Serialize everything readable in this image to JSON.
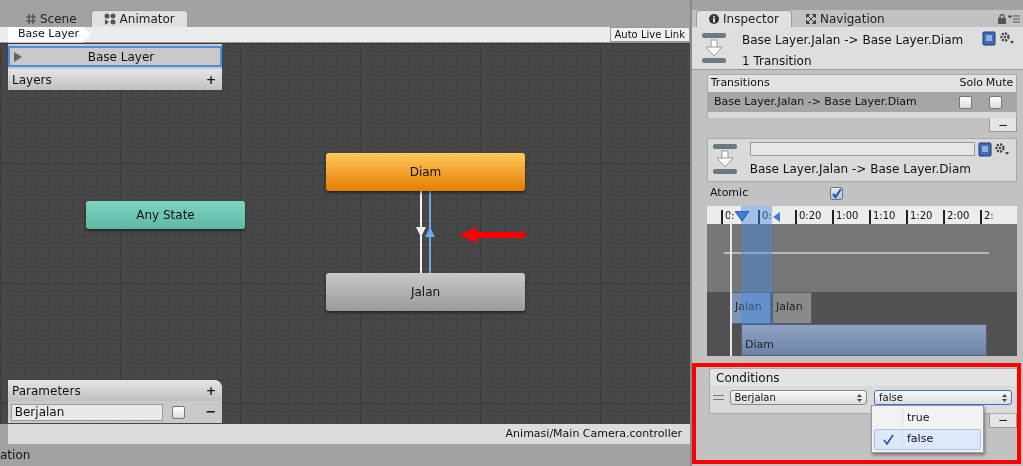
{
  "left_tabs": [
    {
      "label": "Scene",
      "kind": "scene",
      "selected": false
    },
    {
      "label": "Animator",
      "kind": "animator",
      "selected": true
    }
  ],
  "breadcrumb": "Base Layer",
  "auto_live_link": "Auto Live Link",
  "layers": {
    "title": "Layers",
    "add": "+",
    "items": [
      {
        "name": "Base Layer",
        "selected": true
      }
    ]
  },
  "states": [
    {
      "name": "Any State",
      "kind": "any"
    },
    {
      "name": "Diam",
      "kind": "default"
    },
    {
      "name": "Jalan",
      "kind": "normal"
    }
  ],
  "transitions": [
    {
      "kind": "down",
      "selected": false
    },
    {
      "kind": "up",
      "selected": true
    }
  ],
  "parameters": {
    "title": "Parameters",
    "add": "+",
    "remove": "−",
    "items": [
      {
        "name": "Berjalan",
        "kind": "bool",
        "value": false
      }
    ]
  },
  "status_path": "Animasi/Main Camera.controller",
  "bottom_tab": "ation",
  "right_tabs": [
    {
      "label": "Inspector",
      "kind": "info",
      "selected": true
    },
    {
      "label": "Navigation",
      "kind": "navigation",
      "selected": false
    }
  ],
  "inspector": {
    "title": "Base Layer.Jalan -> Base Layer.Diam",
    "subtitle": "1 Transition"
  },
  "transition_list": {
    "title": "Transitions",
    "solo": "Solo",
    "mute": "Mute",
    "remove": "−",
    "rows": [
      {
        "name": "Base Layer.Jalan -> Base Layer.Diam",
        "solo": false,
        "mute": false,
        "selected": true
      }
    ]
  },
  "transition_detail": {
    "label": "Base Layer.Jalan -> Base Layer.Diam"
  },
  "atomic": {
    "label": "Atomic",
    "checked": true
  },
  "timeline": {
    "ticks": [
      "0:",
      "0:",
      "0:20",
      "1:00",
      "1:10",
      "1:20",
      "2:00",
      "2:"
    ],
    "clips": [
      {
        "label": "Jalan",
        "kind": "source"
      },
      {
        "label": "Jalan",
        "kind": "source_next"
      },
      {
        "label": "Diam",
        "kind": "target"
      }
    ]
  },
  "conditions": {
    "title": "Conditions",
    "remove": "−",
    "rows": [
      {
        "parameter": "Berjalan",
        "value": "false"
      }
    ],
    "options": [
      {
        "label": "true",
        "selected": false
      },
      {
        "label": "false",
        "selected": true
      }
    ]
  }
}
